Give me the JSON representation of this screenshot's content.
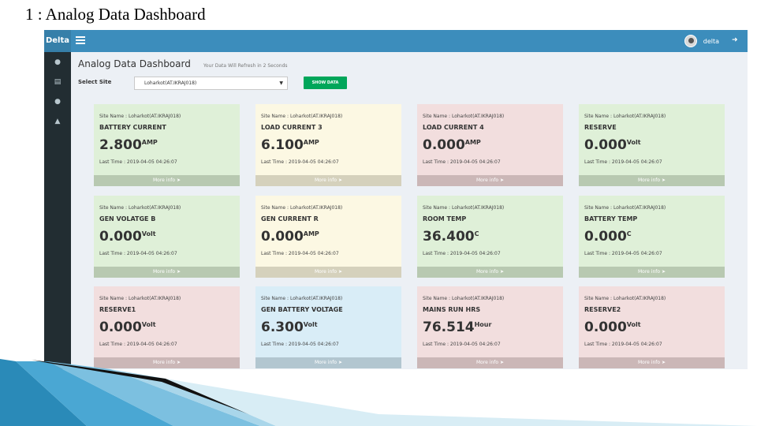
{
  "slide": {
    "title": "1 : Analog Data Dashboard"
  },
  "app": {
    "logo": "Delta",
    "user": "delta",
    "icons": {
      "menu": "hamburger-icon",
      "signout": "sign-out-icon"
    }
  },
  "sidebar": {
    "items": [
      {
        "icon": "dashboard-icon"
      },
      {
        "icon": "chart-icon"
      },
      {
        "icon": "dashboard-icon"
      },
      {
        "icon": "sitemap-icon"
      }
    ]
  },
  "page": {
    "title": "Analog Data Dashboard",
    "subtitle": "Your Data Will Refresh in 2 Seconds",
    "site_label": "Select Site",
    "site_value": "Loharkot(AT.IKRAJ018)",
    "show_button": "SHOW DATA"
  },
  "cards": [
    {
      "site": "Site Name : Loharkot(AT.IKRAJ018)",
      "name": "BATTERY CURRENT",
      "value": "2.800",
      "unit": "AMP",
      "time": "Last Time : 2019-04-05 04:26:07",
      "more": "More info",
      "color": "green"
    },
    {
      "site": "Site Name : Loharkot(AT.IKRAJ018)",
      "name": "LOAD CURRENT 3",
      "value": "6.100",
      "unit": "AMP",
      "time": "Last Time : 2019-04-05 04:26:07",
      "more": "More info",
      "color": "yellow"
    },
    {
      "site": "Site Name : Loharkot(AT.IKRAJ018)",
      "name": "LOAD CURRENT 4",
      "value": "0.000",
      "unit": "AMP",
      "time": "Last Time : 2019-04-05 04:26:07",
      "more": "More info",
      "color": "red"
    },
    {
      "site": "Site Name : Loharkot(AT.IKRAJ018)",
      "name": "RESERVE",
      "value": "0.000",
      "unit": "Volt",
      "time": "Last Time : 2019-04-05 04:26:07",
      "more": "More info",
      "color": "green"
    },
    {
      "site": "Site Name : Loharkot(AT.IKRAJ018)",
      "name": "GEN VOLATGE B",
      "value": "0.000",
      "unit": "Volt",
      "time": "Last Time : 2019-04-05 04:26:07",
      "more": "More info",
      "color": "green"
    },
    {
      "site": "Site Name : Loharkot(AT.IKRAJ018)",
      "name": "GEN CURRENT R",
      "value": "0.000",
      "unit": "AMP",
      "time": "Last Time : 2019-04-05 04:26:07",
      "more": "More info",
      "color": "yellow"
    },
    {
      "site": "Site Name : Loharkot(AT.IKRAJ018)",
      "name": "ROOM TEMP",
      "value": "36.400",
      "unit": "C",
      "time": "Last Time : 2019-04-05 04:26:07",
      "more": "More info",
      "color": "green"
    },
    {
      "site": "Site Name : Loharkot(AT.IKRAJ018)",
      "name": "BATTERY TEMP",
      "value": "0.000",
      "unit": "C",
      "time": "Last Time : 2019-04-05 04:26:07",
      "more": "More info",
      "color": "green"
    },
    {
      "site": "Site Name : Loharkot(AT.IKRAJ018)",
      "name": "RESERVE1",
      "value": "0.000",
      "unit": "Volt",
      "time": "Last Time : 2019-04-05 04:26:07",
      "more": "More info",
      "color": "red"
    },
    {
      "site": "Site Name : Loharkot(AT.IKRAJ018)",
      "name": "GEN BATTERY VOLTAGE",
      "value": "6.300",
      "unit": "Volt",
      "time": "Last Time : 2019-04-05 04:26:07",
      "more": "More info",
      "color": "blue"
    },
    {
      "site": "Site Name : Loharkot(AT.IKRAJ018)",
      "name": "MAINS RUN HRS",
      "value": "76.514",
      "unit": "Hour",
      "time": "Last Time : 2019-04-05 04:26:07",
      "more": "More info",
      "color": "red"
    },
    {
      "site": "Site Name : Loharkot(AT.IKRAJ018)",
      "name": "RESERVE2",
      "value": "0.000",
      "unit": "Volt",
      "time": "Last Time : 2019-04-05 04:26:07",
      "more": "More info",
      "color": "red"
    }
  ],
  "colors": {
    "header": "#3c8dbc",
    "sidebar": "#222d32",
    "green": "#dff0d8",
    "yellow": "#fcf8e3",
    "red": "#f2dede",
    "blue": "#d9edf7",
    "button": "#00a65a"
  }
}
